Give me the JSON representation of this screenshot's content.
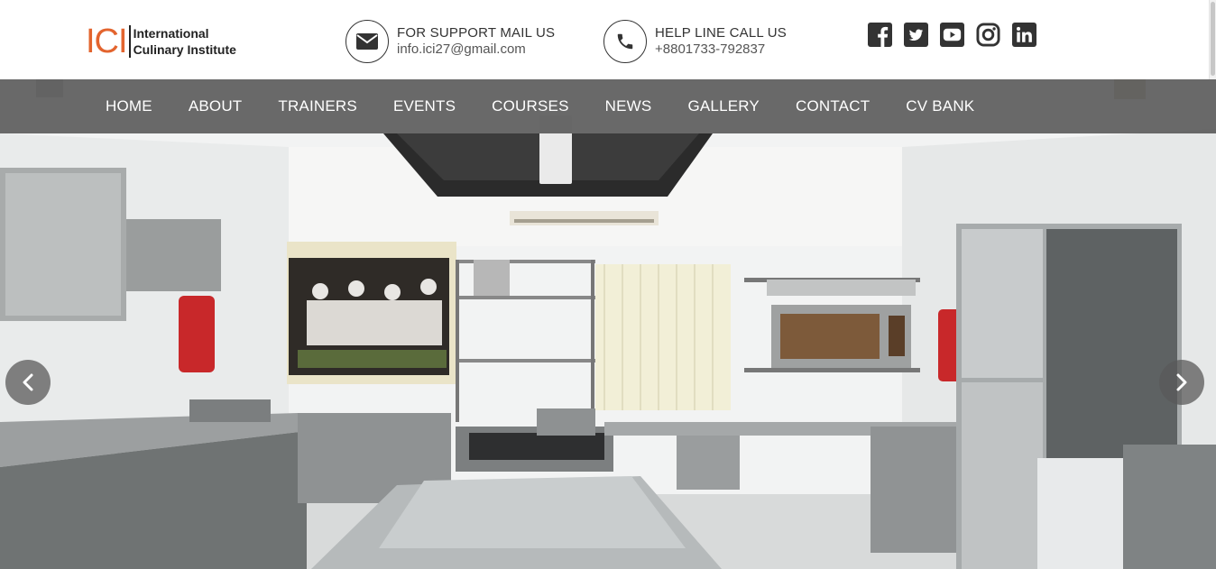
{
  "logo": {
    "mark": "ICI",
    "line1": "International",
    "line2": "Culinary Institute",
    "accent_color": "#e3642e"
  },
  "support": {
    "icon": "envelope-icon",
    "title": "FOR SUPPORT MAIL US",
    "value": "info.ici27@gmail.com"
  },
  "helpline": {
    "icon": "phone-icon",
    "title": "HELP LINE CALL US",
    "value": "+8801733-792837"
  },
  "social": [
    {
      "name": "facebook-icon"
    },
    {
      "name": "twitter-icon"
    },
    {
      "name": "youtube-icon"
    },
    {
      "name": "instagram-icon"
    },
    {
      "name": "linkedin-icon"
    }
  ],
  "nav": {
    "items": [
      "HOME",
      "ABOUT",
      "TRAINERS",
      "EVENTS",
      "COURSES",
      "NEWS",
      "GALLERY",
      "CONTACT",
      "CV BANK"
    ]
  },
  "slider": {
    "prev_icon": "chevron-left-icon",
    "next_icon": "chevron-right-icon"
  },
  "colors": {
    "navbar_bg": "#4b4b4b",
    "icon_dark": "#333333"
  }
}
